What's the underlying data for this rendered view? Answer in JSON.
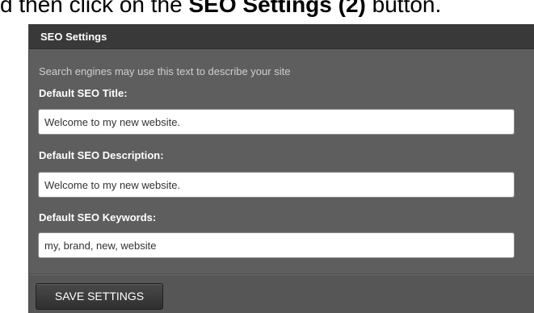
{
  "caption": {
    "prefix": "d then click on the ",
    "bold": "SEO Settings (2)",
    "suffix": " button."
  },
  "panel": {
    "title": "SEO Settings",
    "hint": "Search engines may use this text to describe your site",
    "fields": [
      {
        "label": "Default SEO Title:",
        "value": "Welcome to my new website."
      },
      {
        "label": "Default SEO Description:",
        "value": "Welcome to my new website."
      },
      {
        "label": "Default SEO Keywords:",
        "value": "my, brand, new, website"
      }
    ],
    "save_label": "SAVE SETTINGS"
  },
  "colors": {
    "panel_bg": "#5e5e5e",
    "header_bg": "#393939",
    "button_bg": "#3a3a3a"
  }
}
